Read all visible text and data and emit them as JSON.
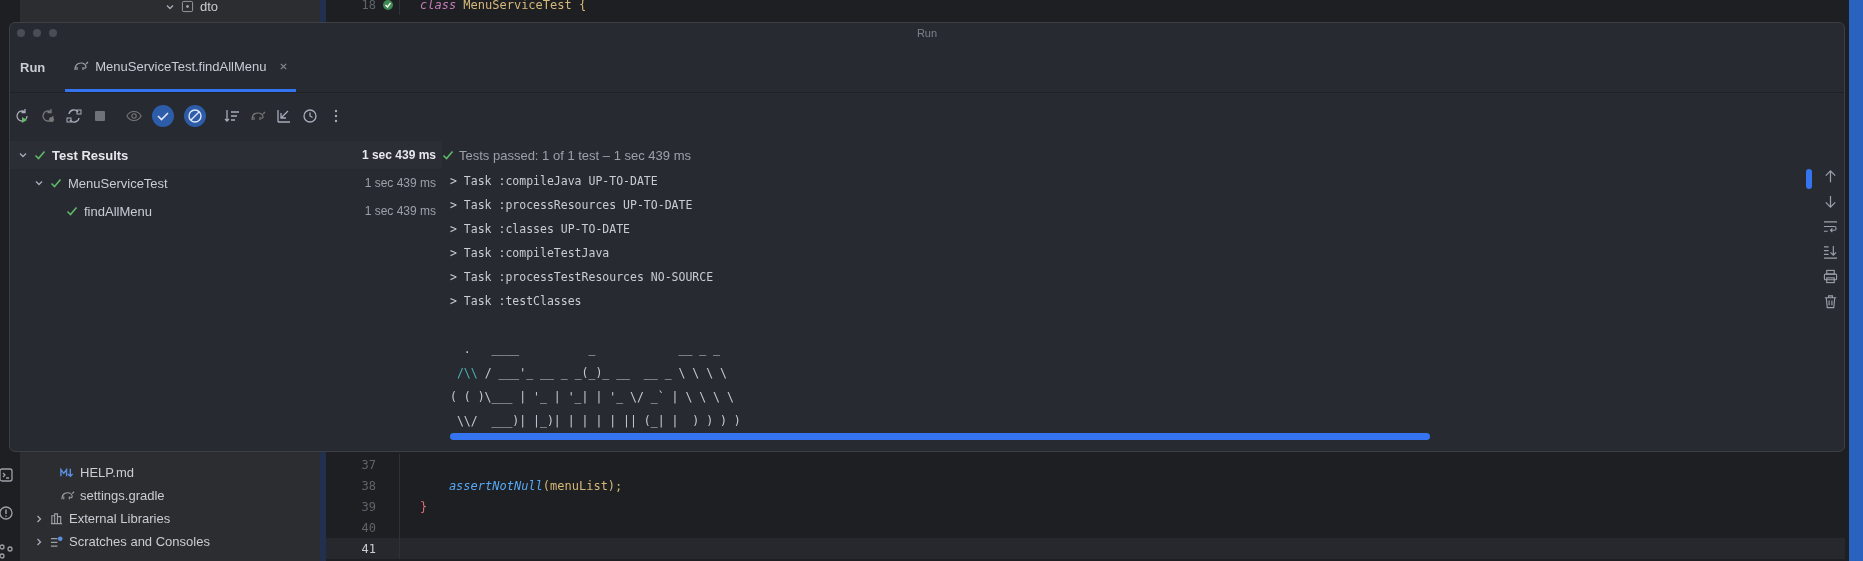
{
  "project_tree": {
    "top_items": [
      {
        "label": "dto",
        "kind": "package",
        "expanded": true
      }
    ],
    "bottom_items": [
      {
        "label": "HELP.md",
        "kind": "markdown"
      },
      {
        "label": "settings.gradle",
        "kind": "gradle"
      },
      {
        "label": "External Libraries",
        "kind": "library",
        "expanded": false
      },
      {
        "label": "Scratches and Consoles",
        "kind": "scratch",
        "expanded": false
      }
    ]
  },
  "editor": {
    "top_lines": [
      {
        "number": "18",
        "passed": true,
        "code": [
          {
            "text": "class",
            "kind": "keyword"
          },
          {
            "text": " MenuServiceTest {",
            "kind": "plain"
          }
        ]
      }
    ],
    "bottom_lines": [
      {
        "number": "37",
        "current": false
      },
      {
        "number": "38",
        "current": false,
        "code": [
          {
            "text": "    assertNotNull",
            "kind": "method"
          },
          {
            "text": "(menuList);",
            "kind": "plain"
          }
        ]
      },
      {
        "number": "39",
        "current": false,
        "code": [
          {
            "text": "}",
            "kind": "brace"
          }
        ]
      },
      {
        "number": "40",
        "current": false
      },
      {
        "number": "41",
        "current": true
      }
    ]
  },
  "run_window": {
    "title": "Run",
    "tool_label": "Run",
    "tabs": [
      {
        "label": "MenuServiceTest.findAllMenu",
        "selected": true
      }
    ],
    "filters": [
      {
        "kind": "passed",
        "on": true
      },
      {
        "kind": "ignored",
        "on": true
      }
    ],
    "test_tree": [
      {
        "label": "Test Results",
        "time": "1 sec 439 ms",
        "kind": "passed",
        "selected": true,
        "expanded": true,
        "children": [
          {
            "label": "MenuServiceTest",
            "time": "1 sec 439 ms",
            "kind": "passed",
            "selected": false,
            "expanded": true,
            "children": [
              {
                "label": "findAllMenu",
                "time": "1 sec 439 ms",
                "kind": "passed",
                "selected": false
              }
            ]
          }
        ]
      }
    ],
    "console": {
      "status": {
        "text": "Tests passed: 1 of 1 test – 1 sec 439 ms",
        "kind": "passed"
      },
      "lines": [
        "> Task :compileJava UP-TO-DATE",
        "> Task :processResources UP-TO-DATE",
        "> Task :classes UP-TO-DATE",
        "> Task :compileTestJava",
        "> Task :processTestResources NO-SOURCE",
        "> Task :testClasses"
      ],
      "banner": [
        [
          {
            "text": "  .   ____          _            __ _ _",
            "kind": "plain"
          }
        ],
        [
          {
            "text": " /\\\\",
            "kind": "accent"
          },
          {
            "text": " / ___'_ __ _ _(_)_ __  __ _ \\ \\ \\ \\",
            "kind": "plain"
          }
        ],
        [
          {
            "text": "( ( )\\___ | '_ | '_| | '_ \\/ _` | \\ \\ \\ \\",
            "kind": "plain"
          }
        ],
        [
          {
            "text": " \\\\/  ___)| |_)| | | | | || (_| |  ) ) ) )",
            "kind": "plain"
          }
        ]
      ]
    }
  }
}
